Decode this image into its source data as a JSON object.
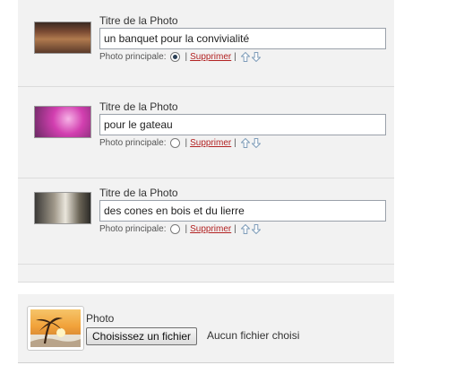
{
  "photos": [
    {
      "title_label": "Titre de la Photo",
      "title_value": "un banquet pour la convivialité",
      "main_label": "Photo principale:",
      "main_selected": true,
      "delete_label": "Supprimer"
    },
    {
      "title_label": "Titre de la Photo",
      "title_value": "pour le gateau",
      "main_label": "Photo principale:",
      "main_selected": false,
      "delete_label": "Supprimer"
    },
    {
      "title_label": "Titre de la Photo",
      "title_value": "des cones en bois et du lierre",
      "main_label": "Photo principale:",
      "main_selected": false,
      "delete_label": "Supprimer"
    }
  ],
  "separator": "|",
  "upload": {
    "label": "Photo",
    "button_label": "Choisissez un fichier",
    "status": "Aucun fichier choisi"
  },
  "colors": {
    "panel_bg": "#f2f2f2",
    "delete_link": "#b22222",
    "arrow": "#7f9db9"
  },
  "icons": [
    "photo-thumbnail",
    "radio",
    "arrow-up-icon",
    "arrow-down-icon",
    "placeholder-image-icon"
  ]
}
